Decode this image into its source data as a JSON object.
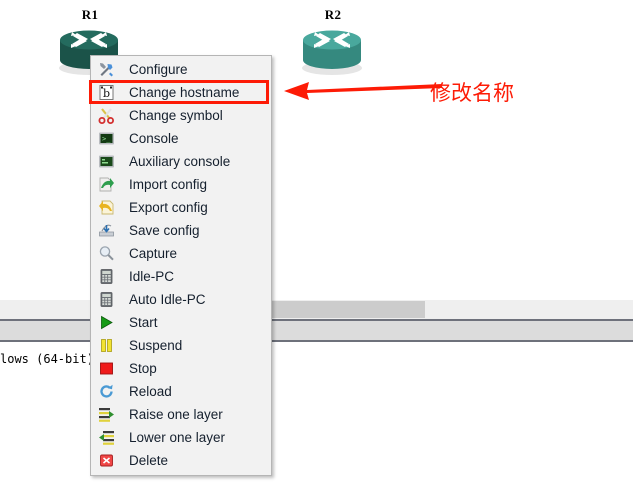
{
  "workspace": {
    "nodes": [
      {
        "label": "R1",
        "icon": "router-icon",
        "color": "#1f5d52",
        "state": "normal"
      },
      {
        "label": "R2",
        "icon": "router-icon",
        "color": "#3d9b91",
        "state": "selected"
      }
    ]
  },
  "annotation": {
    "text": "修改名称",
    "color": "#fd1b06",
    "arrow_icon": "left-arrow-icon",
    "points_to": "Change hostname"
  },
  "console": {
    "text": "lows (64-bit)."
  },
  "panels": {
    "scrollbar_icon": "horizontal-scrollbar",
    "thumb_color": "#cccccc",
    "track_color": "#efefef",
    "band_color": "#dcdcdc",
    "divider_color": "#6e717b"
  },
  "context_menu": {
    "highlight_color": "#fd1b06",
    "highlighted_index": 1,
    "items": [
      {
        "label": "Configure",
        "icon": "wrench-screwdriver-icon"
      },
      {
        "label": "Change hostname",
        "icon": "rename-b-icon"
      },
      {
        "label": "Change symbol",
        "icon": "scissors-icon"
      },
      {
        "label": "Console",
        "icon": "terminal-icon"
      },
      {
        "label": "Auxiliary console",
        "icon": "aux-terminal-icon"
      },
      {
        "label": "Import config",
        "icon": "import-arrow-icon"
      },
      {
        "label": "Export config",
        "icon": "export-arrow-icon"
      },
      {
        "label": "Save config",
        "icon": "save-disk-icon"
      },
      {
        "label": "Capture",
        "icon": "magnifier-icon"
      },
      {
        "label": "Idle-PC",
        "icon": "calculator-icon"
      },
      {
        "label": "Auto Idle-PC",
        "icon": "calculator-icon"
      },
      {
        "label": "Start",
        "icon": "play-icon"
      },
      {
        "label": "Suspend",
        "icon": "pause-icon"
      },
      {
        "label": "Stop",
        "icon": "stop-icon"
      },
      {
        "label": "Reload",
        "icon": "reload-icon"
      },
      {
        "label": "Raise one layer",
        "icon": "raise-layer-icon"
      },
      {
        "label": "Lower one layer",
        "icon": "lower-layer-icon"
      },
      {
        "label": "Delete",
        "icon": "delete-x-icon"
      }
    ]
  }
}
